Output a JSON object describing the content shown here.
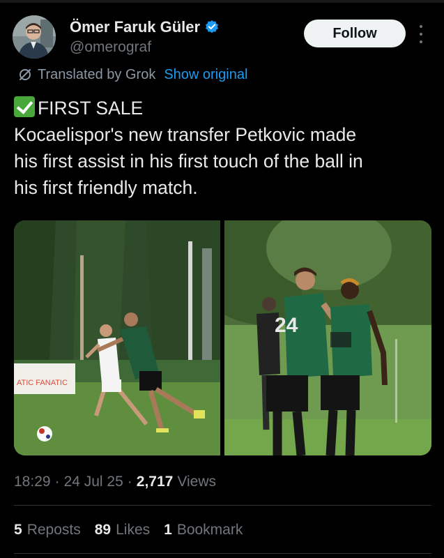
{
  "author": {
    "name": "Ömer Faruk Güler",
    "handle": "@omerograf",
    "verified": true
  },
  "actions": {
    "follow_label": "Follow"
  },
  "translation": {
    "label": "Translated by Grok",
    "show_original": "Show original"
  },
  "tweet": {
    "lines": [
      "FIRST SALE",
      "Kocaelispor's new transfer Petkovic made",
      "his first assist in his first touch of the ball in",
      "his first friendly match."
    ]
  },
  "media": {
    "left_banner_text": "ATIC  FANATIC",
    "right_jersey_number": "24"
  },
  "meta": {
    "time": "18:29",
    "date": "24 Jul 25",
    "views_count": "2,717",
    "views_label": "Views"
  },
  "stats": {
    "reposts_count": "5",
    "reposts_label": "Reposts",
    "likes_count": "89",
    "likes_label": "Likes",
    "bookmarks_count": "1",
    "bookmarks_label": "Bookmark"
  },
  "colors": {
    "background": "#000000",
    "accent": "#1d9bf0",
    "muted": "#71767b",
    "text": "#e7e9ea",
    "follow_bg": "#eff3f4"
  },
  "icons": [
    "verified-badge-icon",
    "grok-icon",
    "more-icon",
    "check-mark-emoji"
  ]
}
